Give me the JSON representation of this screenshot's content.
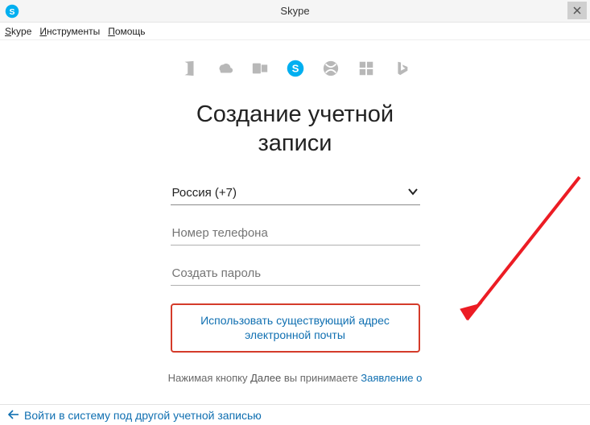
{
  "window": {
    "title": "Skype"
  },
  "menu": {
    "items": [
      "Skype",
      "Инструменты",
      "Помощь"
    ]
  },
  "icons": [
    "office-icon",
    "onedrive-icon",
    "outlook-icon",
    "skype-large-icon",
    "xbox-icon",
    "windows-icon",
    "bing-icon"
  ],
  "heading": {
    "line1": "Создание учетной",
    "line2": "записи"
  },
  "form": {
    "country_selected": "Россия (+7)",
    "phone_placeholder": "Номер телефона",
    "password_placeholder": "Создать пароль"
  },
  "alt_link": {
    "line1": "Использовать существующий адрес",
    "line2": "электронной почты"
  },
  "terms": {
    "prefix": "Нажимая кнопку ",
    "bold": "Далее",
    "mid": " вы принимаете ",
    "link": "Заявление о"
  },
  "footer": {
    "back_label": "Войти в систему под другой учетной записью"
  },
  "colors": {
    "accent": "#00aff0",
    "link": "#0f6fb1",
    "highlight_border": "#d43b2a",
    "arrow": "#ec1c24"
  }
}
